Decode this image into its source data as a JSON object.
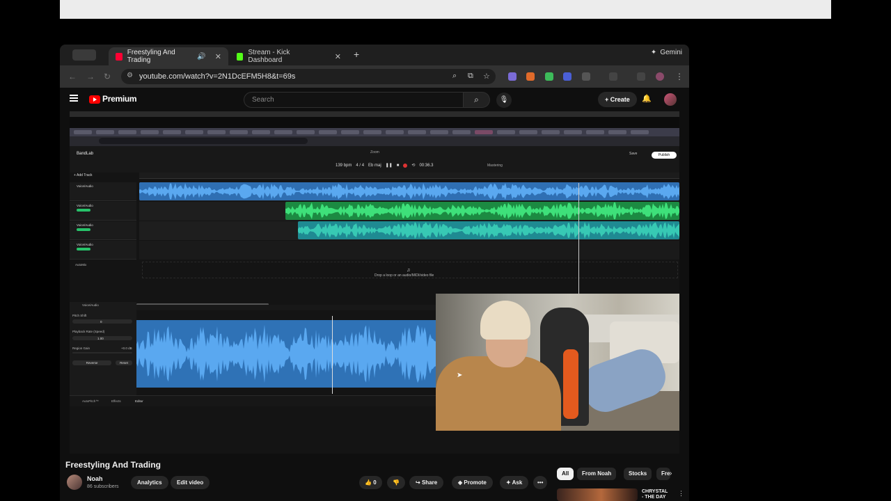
{
  "mac": {
    "apple": ""
  },
  "browser": {
    "tabs": [
      {
        "label": "Freestyling And Trading",
        "favicon_color": "#ff0033",
        "active": true
      },
      {
        "label": "Stream - Kick Dashboard",
        "favicon_color": "#53fc18",
        "active": false
      }
    ],
    "new_tab_icon": "+",
    "gemini_label": "Gemini",
    "url": "youtube.com/watch?v=2N1DcEFM5H8&t=69s",
    "extension_colors": [
      "#7a6bd6",
      "#e06a2a",
      "#3dbb5a",
      "#4a5fd6",
      "#888888"
    ]
  },
  "youtube": {
    "logo_text": "Premium",
    "search_placeholder": "Search",
    "create_label": "Create",
    "video_title": "Freestyling And Trading",
    "channel": {
      "name": "Noah",
      "subscribers": "86 subscribers"
    },
    "buttons": {
      "analytics": "Analytics",
      "edit_video": "Edit video",
      "like_count": "0",
      "share": "Share",
      "promote": "Promote",
      "ask": "Ask",
      "more": "•••"
    },
    "chips": [
      "All",
      "From Noah",
      "Stocks",
      "Fre"
    ],
    "recommendation": {
      "title_line1": "CHRYSTAL",
      "title_line2": "- THE DAY"
    }
  },
  "stream": {
    "bandlab": {
      "logo": "BandLab",
      "project": "Zoom",
      "add_track": "+ Add Track",
      "tempo": "139 bpm",
      "meter": "4 / 4",
      "key": "Eb maj",
      "time": "00:36.3",
      "mastering": "Mastering",
      "save": "Save",
      "publish": "Publish",
      "tracks": [
        "Voice/Audio",
        "Voice/Audio",
        "Voice/Audio",
        "Voice/Audio"
      ],
      "automix": "AutoMix",
      "drop_hint": "Drop a loop or an audio/MIDI/video file",
      "editor": {
        "track_label": "Voice/Audio",
        "pitch_shift": "Pitch Shift",
        "pitch_value": "0",
        "playback_rate": "Playback Rate (Speed)",
        "playback_value": "1.00",
        "region_gain": "Region Gain",
        "region_value": "+0.0 dB",
        "reverse": "Reverse",
        "reset": "Reset",
        "tabs": [
          "AutoPitch™",
          "Effects",
          "Editor"
        ]
      },
      "colors": {
        "blue": "#2f6fb3",
        "green": "#1c8a42",
        "teal": "#1f8a92",
        "wave_blue": "#5aa8f0",
        "wave_green": "#3ee07a",
        "wave_teal": "#37c9b4"
      }
    }
  }
}
